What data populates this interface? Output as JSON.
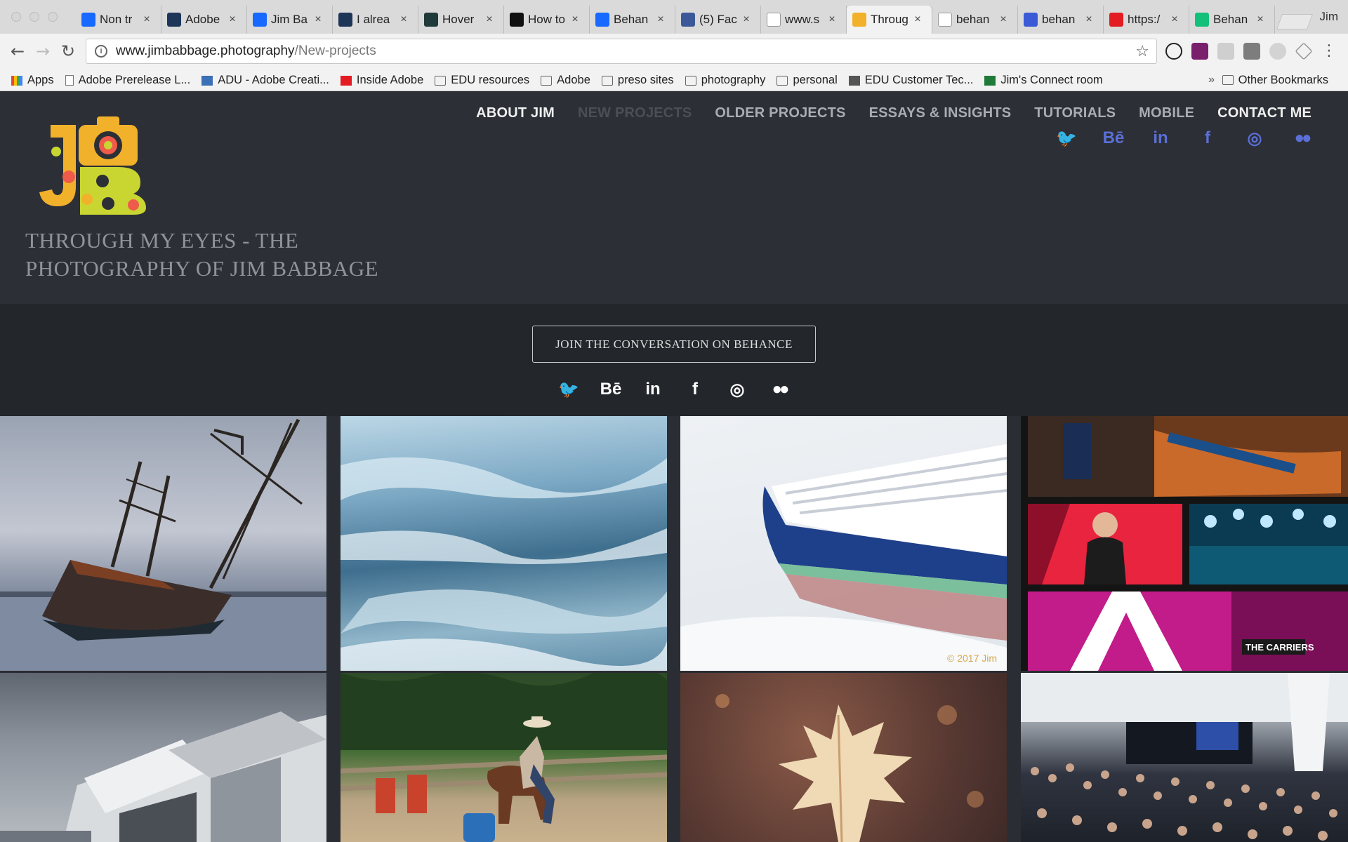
{
  "browser": {
    "tabs": [
      {
        "label": "Non tr",
        "favicon": "behance-icon",
        "color": "#1769ff"
      },
      {
        "label": "Adobe",
        "favicon": "adobe-portfolio-icon",
        "color": "#1d3557"
      },
      {
        "label": "Jim Ba",
        "favicon": "behance-icon",
        "color": "#1769ff"
      },
      {
        "label": "I alrea",
        "favicon": "adobe-portfolio-icon",
        "color": "#1d3557"
      },
      {
        "label": "Hover",
        "favicon": "hover-icon",
        "color": "#1f3a3a"
      },
      {
        "label": "How to",
        "favicon": "plus-icon",
        "color": "#111111"
      },
      {
        "label": "Behan",
        "favicon": "behance-icon",
        "color": "#1769ff"
      },
      {
        "label": "(5) Fac",
        "favicon": "facebook-icon",
        "color": "#3b5998"
      },
      {
        "label": "www.s",
        "favicon": "page-icon",
        "color": "#ffffff"
      },
      {
        "label": "Throug",
        "favicon": "jb-logo-icon",
        "color": "#f2b12b"
      },
      {
        "label": "behan",
        "favicon": "google-icon",
        "color": "#ffffff"
      },
      {
        "label": "behan",
        "favicon": "star-badge-icon",
        "color": "#3b5bd6"
      },
      {
        "label": "https:/",
        "favicon": "adobe-icon",
        "color": "#e31b23"
      },
      {
        "label": "Behan",
        "favicon": "medium-icon",
        "color": "#12c07a"
      }
    ],
    "active_tab_index": 9,
    "profile_name": "Jim",
    "url_domain": "www.jimbabbage.photography",
    "url_path": "/New-projects",
    "bookmarks": [
      {
        "label": "Apps",
        "icon": "apps-grid-icon"
      },
      {
        "label": "Adobe Prerelease L...",
        "icon": "page-icon"
      },
      {
        "label": "ADU - Adobe Creati...",
        "icon": "adu-icon"
      },
      {
        "label": "Inside Adobe",
        "icon": "adobe-icon"
      },
      {
        "label": "EDU resources",
        "icon": "folder-icon"
      },
      {
        "label": "Adobe",
        "icon": "folder-icon"
      },
      {
        "label": "preso sites",
        "icon": "folder-icon"
      },
      {
        "label": "photography",
        "icon": "folder-icon"
      },
      {
        "label": "personal",
        "icon": "folder-icon"
      },
      {
        "label": "EDU Customer Tec...",
        "icon": "doc-check-icon"
      },
      {
        "label": "Jim's Connect room",
        "icon": "connect-icon"
      }
    ],
    "bookmarks_overflow": "»",
    "other_bookmarks": "Other Bookmarks"
  },
  "site": {
    "title_line1": "THROUGH MY EYES - THE",
    "title_line2": "PHOTOGRAPHY OF JIM BABBAGE",
    "nav": [
      {
        "label": "ABOUT JIM",
        "state": "white"
      },
      {
        "label": "NEW PROJECTS",
        "state": "current"
      },
      {
        "label": "OLDER PROJECTS",
        "state": "normal"
      },
      {
        "label": "ESSAYS & INSIGHTS",
        "state": "normal"
      },
      {
        "label": "TUTORIALS",
        "state": "normal"
      },
      {
        "label": "MOBILE",
        "state": "normal"
      },
      {
        "label": "CONTACT ME",
        "state": "white"
      }
    ],
    "social": [
      {
        "name": "twitter-icon",
        "glyph": "🐦"
      },
      {
        "name": "behance-icon",
        "glyph": "Bē"
      },
      {
        "name": "linkedin-icon",
        "glyph": "in"
      },
      {
        "name": "facebook-icon",
        "glyph": "f"
      },
      {
        "name": "instagram-icon",
        "glyph": "◎"
      },
      {
        "name": "flickr-icon",
        "glyph": "●●"
      }
    ],
    "accent_color": "#5b6fd8",
    "join_button": "JOIN THE CONVERSATION ON BEHANCE",
    "projects": [
      "ship-photo",
      "ice-photo",
      "boat-in-snow-photo",
      "event-collage-photo",
      "building-photo",
      "rodeo-photo",
      "leaf-photo",
      "crowd-photo"
    ],
    "event_sign": "THE CARRIERS",
    "watermark": "© 2017 Jim"
  }
}
